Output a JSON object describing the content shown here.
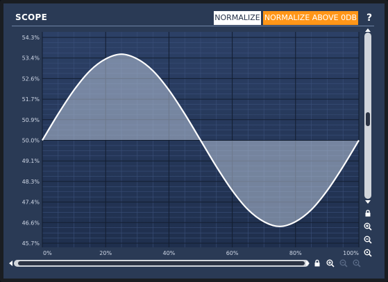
{
  "title": "SCOPE",
  "buttons": {
    "normalize": "NORMALIZE",
    "normalize_above": "NORMALIZE ABOVE 0DB",
    "help": "?"
  },
  "colors": {
    "background": "#2a3a55",
    "plot_bg": "#233555",
    "accent": "#ff9618",
    "wave": "#ffffff",
    "fill": "#9aaac4"
  },
  "chart_data": {
    "type": "area",
    "y_tick_labels": [
      "54.3%",
      "53.4%",
      "52.6%",
      "51.7%",
      "50.9%",
      "50.0%",
      "49.1%",
      "48.3%",
      "47.4%",
      "46.6%",
      "45.7%"
    ],
    "x_tick_labels": [
      "0%",
      "20%",
      "40%",
      "60%",
      "80%",
      "100%"
    ],
    "xlim": [
      0,
      100
    ],
    "ylim": [
      45.7,
      54.3
    ],
    "baseline": 50.0,
    "grid": true,
    "series": [
      {
        "x": [
          0,
          5,
          10,
          15,
          20,
          25,
          30,
          35,
          40,
          45,
          50,
          55,
          60,
          65,
          70,
          75,
          80,
          85,
          90,
          95,
          100
        ],
        "values": [
          50.0,
          51.1,
          52.1,
          52.9,
          53.4,
          53.6,
          53.4,
          52.9,
          52.1,
          51.1,
          50.0,
          48.9,
          47.9,
          47.1,
          46.6,
          46.4,
          46.6,
          47.1,
          47.9,
          48.9,
          50.0
        ]
      }
    ]
  },
  "icons": {
    "v_lock": "lock-icon",
    "v_zoom_in": "zoom-in-icon",
    "v_zoom_out": "zoom-out-icon",
    "v_zoom_reset": "zoom-reset-icon",
    "h_lock": "lock-icon",
    "h_zoom_in": "zoom-in-icon",
    "h_zoom_out": "zoom-out-icon",
    "h_zoom_reset": "zoom-reset-icon"
  }
}
